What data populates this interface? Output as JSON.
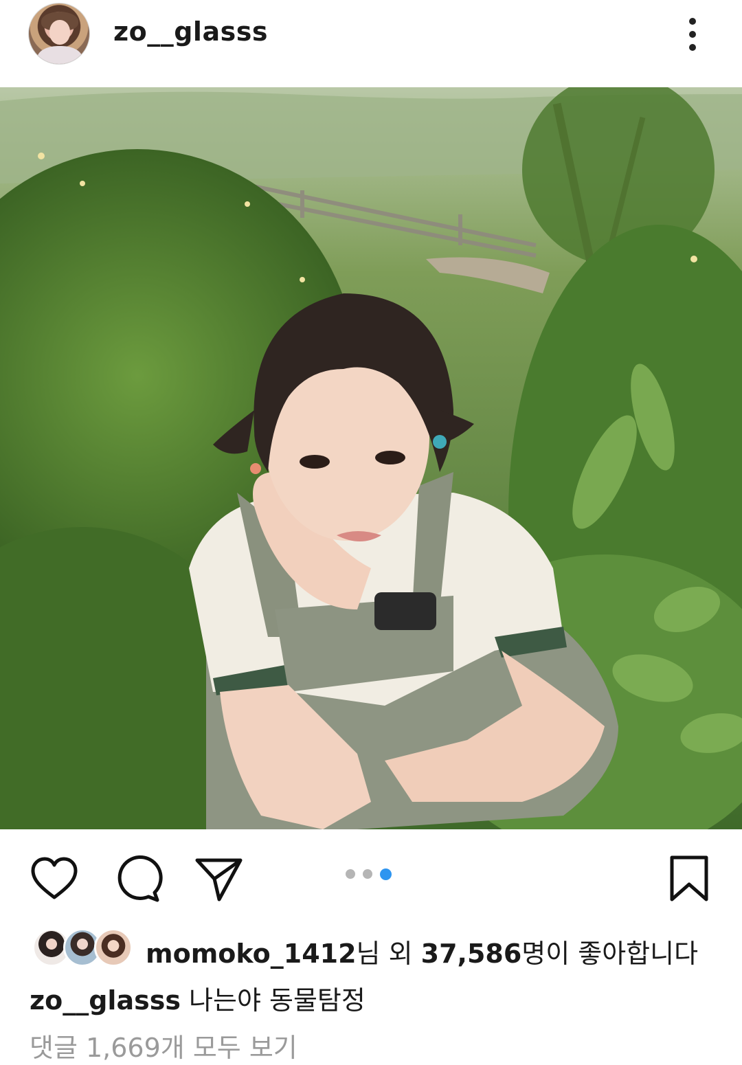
{
  "post": {
    "username": "zo__glasss",
    "more_menu": "more-options",
    "image_alt": "photo",
    "carousel": {
      "count": 3,
      "active_index": 2
    }
  },
  "actions": {
    "like": "heart-icon",
    "comment": "comment-bubble-icon",
    "share": "send-paper-plane-icon",
    "save": "bookmark-icon"
  },
  "likes": {
    "first_liker": "momoko_1412",
    "mid_text": "님 외 ",
    "count": "37,586",
    "suffix": "명이 좋아합니다"
  },
  "caption": {
    "username": "zo__glasss",
    "text": "나는야 동물탐정"
  },
  "comments": {
    "view_all": "댓글 1,669개 모두 보기"
  },
  "colors": {
    "accent_dot": "#2e95f0",
    "inactive_dot": "#b5b5b5",
    "muted_text": "#9a9a9a"
  }
}
